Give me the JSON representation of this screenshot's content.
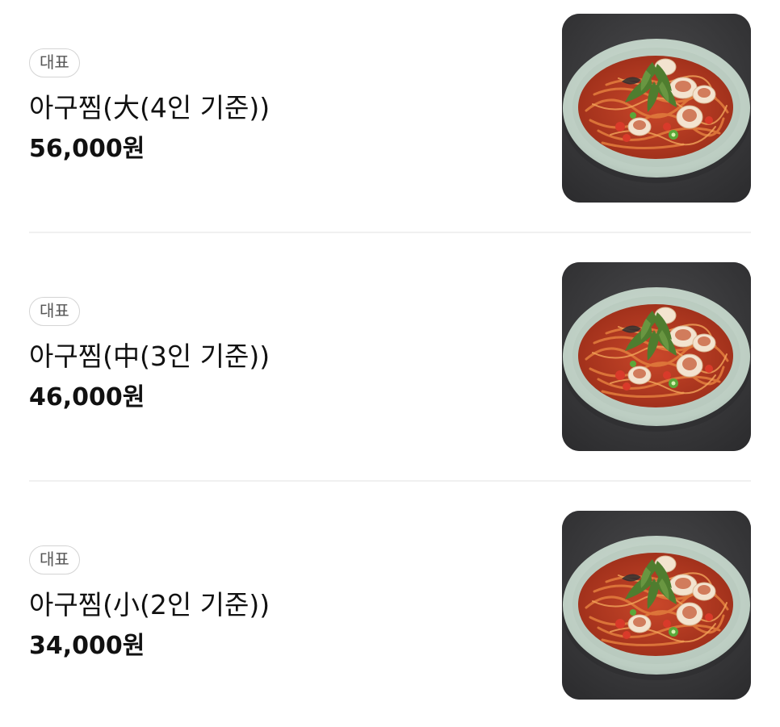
{
  "menu": {
    "items": [
      {
        "badge": "대표",
        "name": "아구찜(大(4인 기준))",
        "price": "56,000원",
        "image": "agujjim-photo"
      },
      {
        "badge": "대표",
        "name": "아구찜(中(3인 기준))",
        "price": "46,000원",
        "image": "agujjim-photo"
      },
      {
        "badge": "대표",
        "name": "아구찜(小(2인 기준))",
        "price": "34,000원",
        "image": "agujjim-photo"
      }
    ]
  },
  "colors": {
    "text": "#111111",
    "badge_text": "#555555",
    "badge_border": "#d4d4d4",
    "divider": "#f0f0f0",
    "photo_background": "#3a3a3c",
    "plate": "#c7d6cc",
    "sauce": "#b8361f"
  }
}
